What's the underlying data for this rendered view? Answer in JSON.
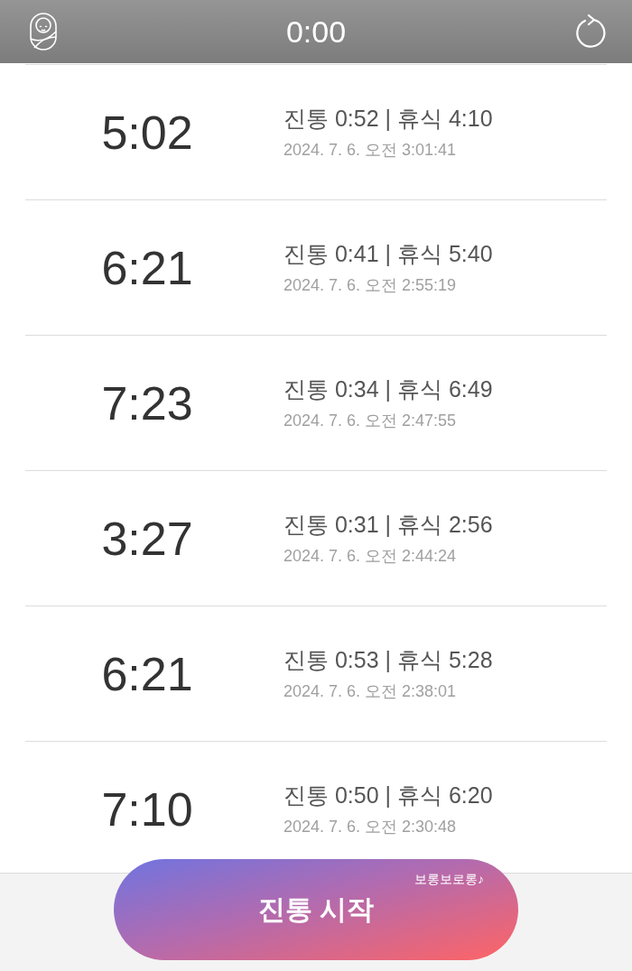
{
  "header": {
    "title": "0:00"
  },
  "records": [
    {
      "duration": "5:02",
      "summary": "진통 0:52 | 휴식 4:10",
      "timestamp": "2024. 7. 6. 오전 3:01:41"
    },
    {
      "duration": "6:21",
      "summary": "진통 0:41 | 휴식 5:40",
      "timestamp": "2024. 7. 6. 오전 2:55:19"
    },
    {
      "duration": "7:23",
      "summary": "진통 0:34 | 휴식 6:49",
      "timestamp": "2024. 7. 6. 오전 2:47:55"
    },
    {
      "duration": "3:27",
      "summary": "진통 0:31 | 휴식 2:56",
      "timestamp": "2024. 7. 6. 오전 2:44:24"
    },
    {
      "duration": "6:21",
      "summary": "진통 0:53 | 휴식 5:28",
      "timestamp": "2024. 7. 6. 오전 2:38:01"
    },
    {
      "duration": "7:10",
      "summary": "진통 0:50 | 휴식 6:20",
      "timestamp": "2024. 7. 6. 오전 2:30:48"
    }
  ],
  "start_button": {
    "label": "진통 시작",
    "badge": "보롱보로롱♪"
  }
}
